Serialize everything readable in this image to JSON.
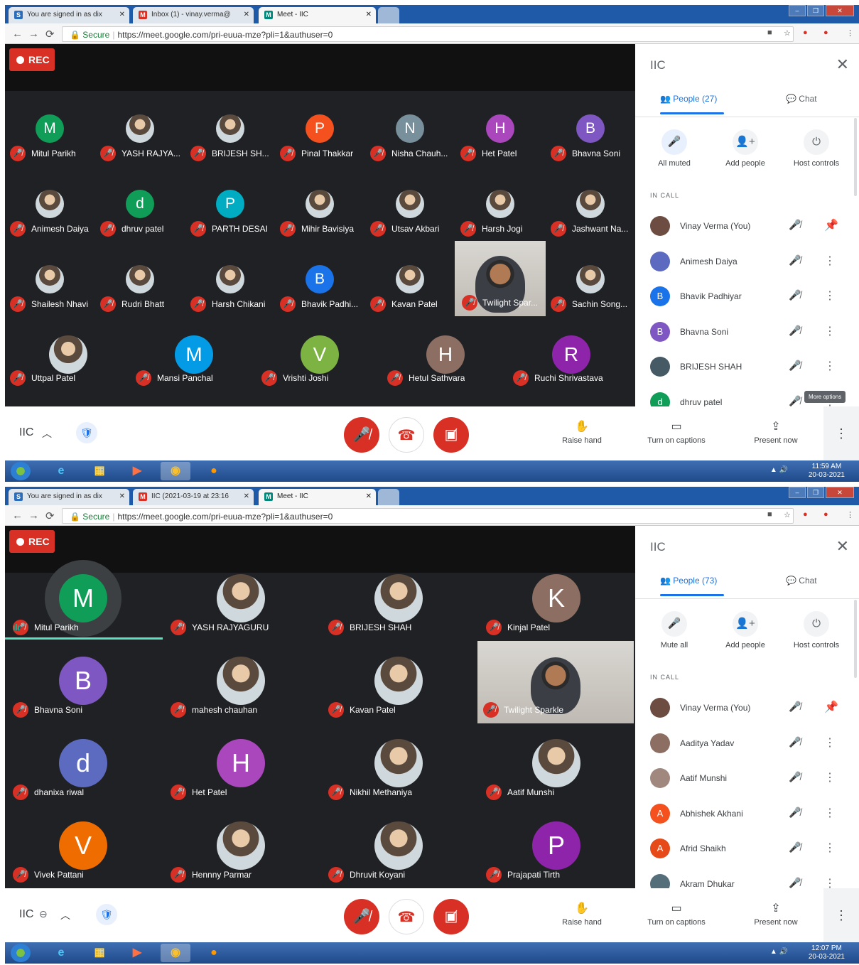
{
  "screens": [
    {
      "tabs": [
        {
          "label": "You are signed in as dix",
          "favicon": "S",
          "color": "#2a6ebb"
        },
        {
          "label": "Inbox (1) - vinay.verma@",
          "favicon": "M",
          "color": "#d93025"
        },
        {
          "label": "Meet - IIC",
          "favicon": "M",
          "color": "#00897b"
        }
      ],
      "address": {
        "secure": "Secure",
        "url": "https://meet.google.com/pri-euua-mze?pli=1&authuser=0"
      },
      "rec": "REC",
      "panel": {
        "title": "IIC",
        "people_tab": "People (27)",
        "chat_tab": "Chat",
        "actions": [
          "All muted",
          "Add people",
          "Host controls"
        ],
        "in_call": "IN CALL",
        "people": [
          {
            "name": "Vinay Verma (You)",
            "initial": "",
            "color": "#6d4c41"
          },
          {
            "name": "Animesh Daiya",
            "initial": "",
            "color": "#5c6bc0"
          },
          {
            "name": "Bhavik Padhiyar",
            "initial": "B",
            "color": "#1a73e8"
          },
          {
            "name": "Bhavna Soni",
            "initial": "B",
            "color": "#7e57c2"
          },
          {
            "name": "BRIJESH SHAH",
            "initial": "",
            "color": "#455a64"
          },
          {
            "name": "dhruv patel",
            "initial": "d",
            "color": "#0f9d58"
          }
        ],
        "tooltip": "More options"
      },
      "controls": {
        "meeting": "IIC",
        "raise": "Raise hand",
        "captions": "Turn on captions",
        "present": "Present now"
      },
      "clock": {
        "time": "11:59 AM",
        "date": "20-03-2021"
      },
      "grid": [
        {
          "name": "Mitul Parikh",
          "initial": "M",
          "color": "#0f9d58"
        },
        {
          "name": "YASH RAJYA...",
          "initial": "",
          "color": "#263238"
        },
        {
          "name": "BRIJESH SH...",
          "initial": "",
          "color": "#455a64"
        },
        {
          "name": "Pinal Thakkar",
          "initial": "P",
          "color": "#f4511e"
        },
        {
          "name": "Nisha Chauh...",
          "initial": "N",
          "color": "#78909c"
        },
        {
          "name": "Het Patel",
          "initial": "H",
          "color": "#ab47bc"
        },
        {
          "name": "Bhavna Soni",
          "initial": "B",
          "color": "#7e57c2"
        },
        {
          "name": "Animesh Daiya",
          "initial": "",
          "color": "#5c6bc0"
        },
        {
          "name": "dhruv patel",
          "initial": "d",
          "color": "#0f9d58"
        },
        {
          "name": "PARTH DESAI",
          "initial": "P",
          "color": "#00acc1"
        },
        {
          "name": "Mihir Bavisiya",
          "initial": "",
          "color": "#8d6e63"
        },
        {
          "name": "Utsav Akbari",
          "initial": "",
          "color": "#5d4037"
        },
        {
          "name": "Harsh Jogi",
          "initial": "",
          "color": "#546e7a"
        },
        {
          "name": "Jashwant Na...",
          "initial": "",
          "color": "#607d8b"
        },
        {
          "name": "Shailesh Nhavi",
          "initial": "",
          "color": "#424242"
        },
        {
          "name": "Rudri Bhatt",
          "initial": "",
          "color": "#bcaaa4"
        },
        {
          "name": "Harsh Chikani",
          "initial": "",
          "color": "#a1887f"
        },
        {
          "name": "Bhavik Padhi...",
          "initial": "B",
          "color": "#1a73e8"
        },
        {
          "name": "Kavan Patel",
          "initial": "",
          "color": "#757575"
        },
        {
          "name": "Twilight Spar...",
          "initial": "",
          "color": "#999"
        },
        {
          "name": "Sachin Song...",
          "initial": "",
          "color": "#90a4ae"
        },
        {
          "name": "Uttpal Patel",
          "initial": "",
          "color": "#616161"
        },
        {
          "name": "Mansi Panchal",
          "initial": "M",
          "color": "#039be5"
        },
        {
          "name": "Vrishti Joshi",
          "initial": "V",
          "color": "#7cb342"
        },
        {
          "name": "Hetul Sathvara",
          "initial": "H",
          "color": "#8d6e63"
        },
        {
          "name": "Ruchi Shrivastava",
          "initial": "R",
          "color": "#8e24aa"
        }
      ]
    },
    {
      "tabs": [
        {
          "label": "You are signed in as dix",
          "favicon": "S",
          "color": "#2a6ebb"
        },
        {
          "label": "IIC (2021-03-19 at 23:16",
          "favicon": "M",
          "color": "#d93025"
        },
        {
          "label": "Meet - IIC",
          "favicon": "M",
          "color": "#00897b"
        }
      ],
      "address": {
        "secure": "Secure",
        "url": "https://meet.google.com/pri-euua-mze?pli=1&authuser=0"
      },
      "rec": "REC",
      "panel": {
        "title": "IIC",
        "people_tab": "People (73)",
        "chat_tab": "Chat",
        "actions": [
          "Mute all",
          "Add people",
          "Host controls"
        ],
        "in_call": "IN CALL",
        "people": [
          {
            "name": "Vinay Verma (You)",
            "initial": "",
            "color": "#6d4c41"
          },
          {
            "name": "Aaditya Yadav",
            "initial": "",
            "color": "#8d6e63"
          },
          {
            "name": "Aatif Munshi",
            "initial": "",
            "color": "#a1887f"
          },
          {
            "name": "Abhishek Akhani",
            "initial": "A",
            "color": "#f4511e"
          },
          {
            "name": "Afrid Shaikh",
            "initial": "A",
            "color": "#e64a19"
          },
          {
            "name": "Akram Dhukar",
            "initial": "",
            "color": "#546e7a"
          }
        ],
        "tooltip": ""
      },
      "controls": {
        "meeting": "IIC",
        "raise": "Raise hand",
        "captions": "Turn on captions",
        "present": "Present now"
      },
      "clock": {
        "time": "12:07 PM",
        "date": "20-03-2021"
      },
      "grid": [
        {
          "name": "Mitul Parikh",
          "initial": "M",
          "color": "#0f9d58"
        },
        {
          "name": "YASH RAJYAGURU",
          "initial": "",
          "color": "#263238"
        },
        {
          "name": "BRIJESH SHAH",
          "initial": "",
          "color": "#455a64"
        },
        {
          "name": "Kinjal Patel",
          "initial": "K",
          "color": "#8d6e63"
        },
        {
          "name": "Bhavna Soni",
          "initial": "B",
          "color": "#7e57c2"
        },
        {
          "name": "mahesh chauhan",
          "initial": "",
          "color": "#c62828"
        },
        {
          "name": "Kavan Patel",
          "initial": "",
          "color": "#757575"
        },
        {
          "name": "Twilight Sparkle",
          "initial": "",
          "color": "#999"
        },
        {
          "name": "dhanixa riwal",
          "initial": "d",
          "color": "#5c6bc0"
        },
        {
          "name": "Het Patel",
          "initial": "H",
          "color": "#ab47bc"
        },
        {
          "name": "Nikhil Methaniya",
          "initial": "",
          "color": "#3e2723"
        },
        {
          "name": "Aatif Munshi",
          "initial": "",
          "color": "#a1887f"
        },
        {
          "name": "Vivek Pattani",
          "initial": "V",
          "color": "#ef6c00"
        },
        {
          "name": "Hennny Parmar",
          "initial": "",
          "color": "#000000"
        },
        {
          "name": "Dhruvit Koyani",
          "initial": "",
          "color": "#1b5e20"
        },
        {
          "name": "Prajapati Tirth",
          "initial": "P",
          "color": "#8e24aa"
        }
      ]
    }
  ]
}
